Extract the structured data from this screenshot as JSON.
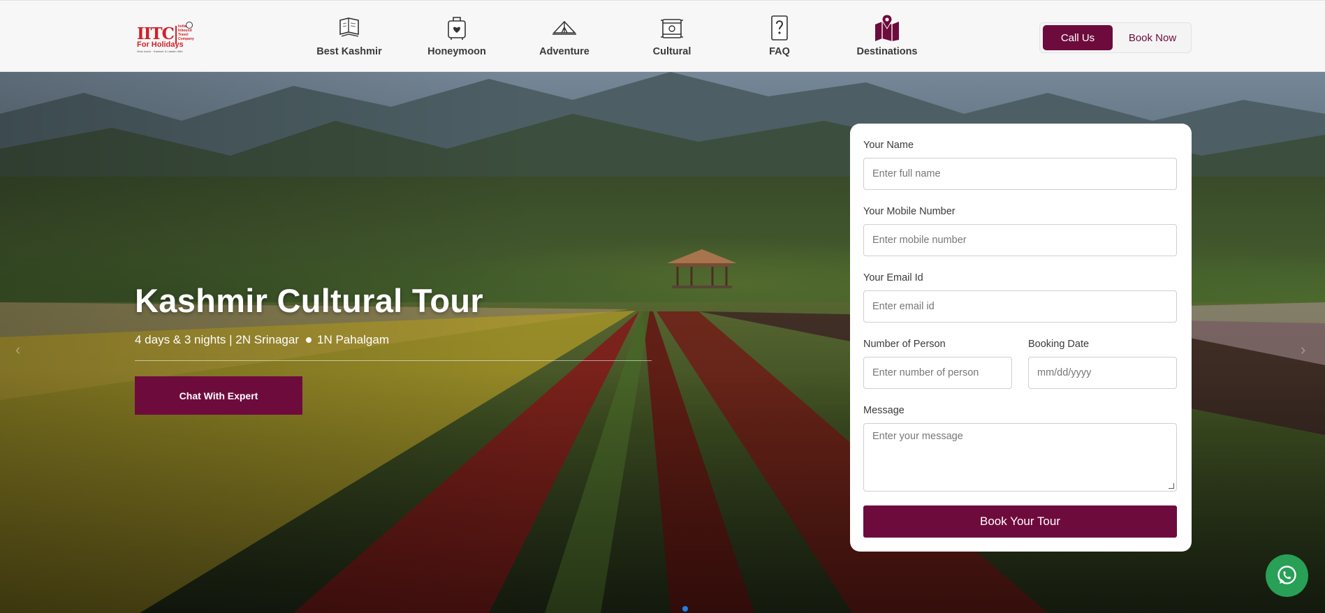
{
  "header": {
    "logo": {
      "brand": "IITC",
      "small_text": "India Inbound Travel Company",
      "sub": "For Holidays",
      "tagline": "Wow Iconic · Kashmir & Ladakh Wild"
    },
    "nav": [
      {
        "label": "Best Kashmir",
        "icon": "map-book-icon"
      },
      {
        "label": "Honeymoon",
        "icon": "luggage-heart-icon"
      },
      {
        "label": "Adventure",
        "icon": "tent-icon"
      },
      {
        "label": "Cultural",
        "icon": "scroll-icon"
      },
      {
        "label": "FAQ",
        "icon": "question-doc-icon"
      },
      {
        "label": "Destinations",
        "icon": "map-pin-icon"
      }
    ],
    "call_label": "Call Us",
    "book_label": "Book Now"
  },
  "hero": {
    "title": "Kashmir Cultural Tour",
    "sub_part1": "4 days & 3 nights | 2N Srinagar",
    "sub_part2": "1N Pahalgam",
    "chat_label": "Chat With Expert",
    "arrow_prev": "‹",
    "arrow_next": "›"
  },
  "form": {
    "name_label": "Your Name",
    "name_placeholder": "Enter full name",
    "mobile_label": "Your Mobile Number",
    "mobile_placeholder": "Enter mobile number",
    "email_label": "Your Email Id",
    "email_placeholder": "Enter email id",
    "persons_label": "Number of Person",
    "persons_placeholder": "Enter number of person",
    "date_label": "Booking Date",
    "date_placeholder": "mm/dd/yyyy",
    "message_label": "Message",
    "message_placeholder": "Enter your message",
    "submit_label": "Book Your Tour"
  },
  "colors": {
    "brand": "#6e0b3d",
    "logo_red": "#d31f26",
    "whatsapp": "#28a055",
    "slide_dot": "#1e7fe6"
  }
}
